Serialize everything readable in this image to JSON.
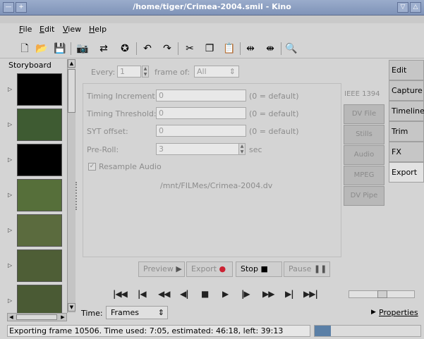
{
  "window": {
    "title": "/home/tiger/Crimea-2004.smil - Kino"
  },
  "menu": [
    {
      "label": "File",
      "u": "F",
      "rest": "ile"
    },
    {
      "label": "Edit",
      "u": "E",
      "rest": "dit"
    },
    {
      "label": "View",
      "u": "V",
      "rest": "iew"
    },
    {
      "label": "Help",
      "u": "H",
      "rest": "elp"
    }
  ],
  "storyboard": {
    "header": "Storyboard",
    "thumb_colors": [
      "#000000",
      "#3e5b32",
      "#000000",
      "#566f3a",
      "#5b6b3e",
      "#4e5e36",
      "#4a5a34"
    ]
  },
  "export": {
    "every_label": "Every:",
    "every_value": "1",
    "frame_of_label": "frame of:",
    "frame_of_value": "All",
    "fields": [
      {
        "label": "Timing Increment:",
        "value": "0",
        "hint": "(0 = default)"
      },
      {
        "label": "Timing Threshold:",
        "value": "0",
        "hint": "(0 = default)"
      },
      {
        "label": "SYT offset:",
        "value": "0",
        "hint": "(0 = default)"
      },
      {
        "label": "Pre-Roll:",
        "value": "3",
        "hint": "sec"
      }
    ],
    "resample_label": "Resample Audio",
    "resample_checked": true,
    "path": "/mnt/FILMes/Crimea-2004.dv",
    "ieee_tab": "IEEE 1394",
    "subtabs": [
      "DV File",
      "Stills",
      "Audio",
      "MPEG",
      "DV Pipe"
    ]
  },
  "side_tabs": [
    "Edit",
    "Capture",
    "Timeline",
    "Trim",
    "FX",
    "Export"
  ],
  "buttons": {
    "preview": "Preview",
    "export": "Export",
    "stop": "Stop",
    "pause": "Pause"
  },
  "transport_icons": [
    "first-icon",
    "prev-scene-icon",
    "rewind-icon",
    "prev-frame-icon",
    "stop-icon",
    "play-icon",
    "next-frame-icon",
    "fast-forward-icon",
    "next-scene-icon",
    "last-icon"
  ],
  "bottom": {
    "time_label": "Time:",
    "time_value": "Frames",
    "properties": "Properties"
  },
  "status": {
    "text": "Exporting frame 10506. Time  used: 7:05,  estimated: 46:18,  left: 39:13",
    "progress": 0.15
  },
  "colors": {
    "title_bar": "#8ea0c2",
    "progress": "#5a7fa6"
  }
}
